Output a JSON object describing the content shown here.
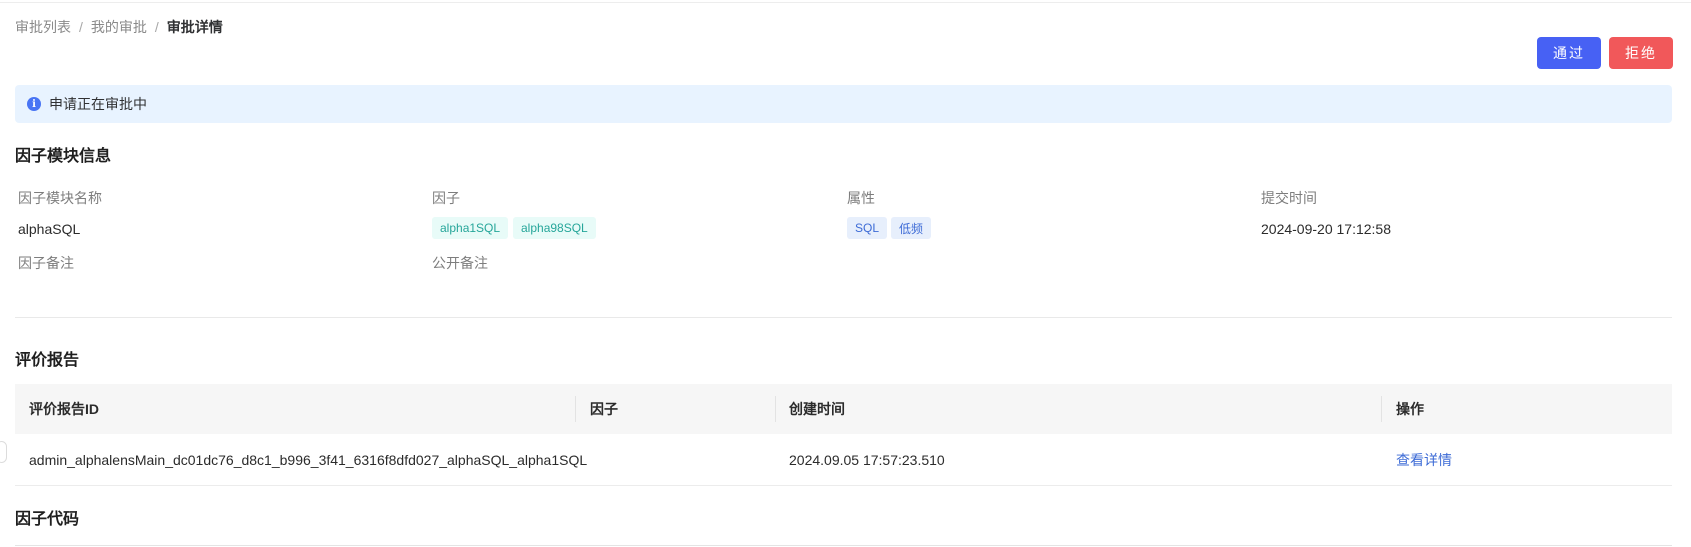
{
  "breadcrumb": {
    "items": [
      "审批列表",
      "我的审批"
    ],
    "separator": "/",
    "current": "审批详情"
  },
  "actions": {
    "approve_label": "通过",
    "reject_label": "拒绝"
  },
  "alert": {
    "icon_glyph": "i",
    "message": "申请正在审批中"
  },
  "factor_module": {
    "title": "因子模块信息",
    "labels": {
      "name": "因子模块名称",
      "factors": "因子",
      "attributes": "属性",
      "submit_time": "提交时间",
      "factor_note": "因子备注",
      "public_note": "公开备注"
    },
    "name": "alphaSQL",
    "factors": [
      "alpha1SQL",
      "alpha98SQL"
    ],
    "attributes": [
      "SQL",
      "低频"
    ],
    "submit_time": "2024-09-20 17:12:58"
  },
  "report": {
    "title": "评价报告",
    "columns": [
      "评价报告ID",
      "因子",
      "创建时间",
      "操作"
    ],
    "rows": [
      {
        "id": "admin_alphalensMain_dc01dc76_d8c1_b996_3f41_6316f8dfd027_alphaSQL_alpha1SQL",
        "factor": "",
        "created": "2024.09.05 17:57:23.510",
        "action": "查看详情"
      }
    ]
  },
  "code": {
    "title": "因子代码"
  },
  "colors": {
    "approve": "#4761f4",
    "reject": "#f1585a",
    "alert_bg": "#e8f3ff",
    "link": "#3d6bd6"
  }
}
